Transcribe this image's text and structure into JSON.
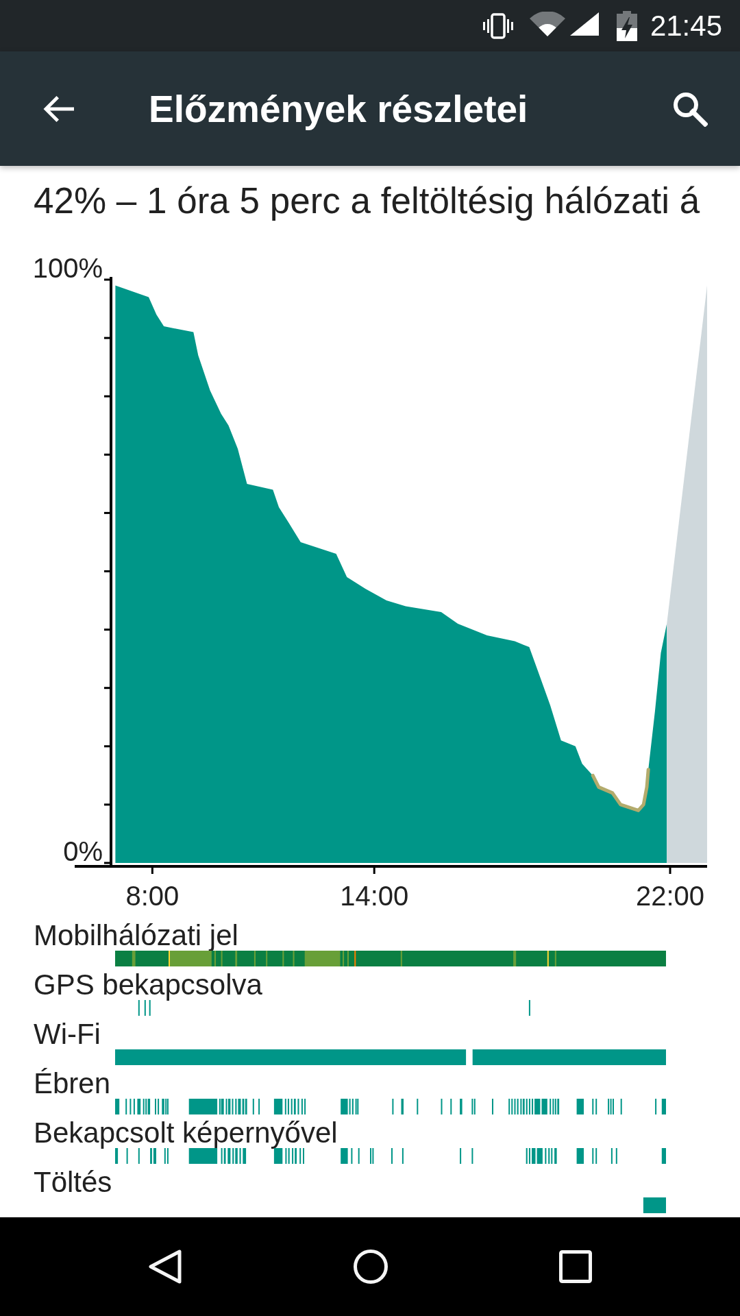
{
  "status_bar": {
    "time": "21:45"
  },
  "toolbar": {
    "title": "Előzmények részletei"
  },
  "summary": "42% – 1 óra 5 perc a feltöltésig hálózati á",
  "chart": {
    "chart_data": {
      "type": "area",
      "x": [
        7.0,
        7.9,
        8.11,
        8.31,
        9.11,
        9.24,
        9.56,
        9.86,
        10.06,
        10.31,
        10.56,
        11.26,
        11.42,
        11.72,
        12.01,
        12.97,
        13.26,
        13.76,
        14.33,
        14.85,
        15.81,
        16.26,
        17.05,
        17.8,
        18.19,
        18.42,
        18.76,
        19.05,
        19.44,
        19.62,
        19.91,
        20.07,
        20.44,
        20.66,
        21.14,
        21.28,
        21.37,
        21.41,
        21.59,
        21.75,
        21.91,
        23.0
      ],
      "xlim": [
        5.9,
        23
      ],
      "ylim": [
        0,
        100
      ],
      "xticks": [
        {
          "value": 8,
          "label": "8:00"
        },
        {
          "value": 14,
          "label": "14:00"
        },
        {
          "value": 22,
          "label": "22:00"
        }
      ],
      "yticks": [
        {
          "value": 0,
          "label": "0%"
        },
        {
          "value": 100,
          "label": "100%"
        }
      ],
      "series": [
        {
          "color": "#009688",
          "values": [
            99,
            97,
            94,
            92,
            91,
            87,
            81,
            77,
            75,
            71,
            65,
            64,
            61,
            58,
            55,
            53,
            49,
            47,
            45,
            44,
            43,
            41,
            39,
            38,
            37,
            33,
            27,
            21,
            20,
            17,
            15,
            13,
            12,
            10,
            9,
            10,
            13,
            16,
            26,
            36,
            41,
            null
          ]
        },
        {
          "color": "#cfd8dc",
          "values": [
            null,
            null,
            null,
            null,
            null,
            null,
            null,
            null,
            null,
            null,
            null,
            null,
            null,
            null,
            null,
            null,
            null,
            null,
            null,
            null,
            null,
            null,
            null,
            null,
            null,
            null,
            null,
            null,
            null,
            null,
            null,
            null,
            null,
            null,
            null,
            null,
            null,
            null,
            null,
            null,
            41,
            99
          ]
        },
        {
          "type": "line",
          "color": "#b3ab6c",
          "values": [
            null,
            null,
            null,
            null,
            null,
            null,
            null,
            null,
            null,
            null,
            null,
            null,
            null,
            null,
            null,
            null,
            null,
            null,
            null,
            null,
            null,
            null,
            null,
            null,
            null,
            null,
            null,
            null,
            null,
            null,
            15,
            13,
            12,
            10,
            9,
            10,
            13,
            16,
            null,
            null,
            null,
            null
          ]
        }
      ]
    }
  },
  "tracks": [
    {
      "label": "Mobilhálózati jel",
      "kind": "signal"
    },
    {
      "label": "GPS bekapcsolva",
      "kind": "gps"
    },
    {
      "label": "Wi-Fi",
      "kind": "wifi"
    },
    {
      "label": "Ébren",
      "kind": "awake"
    },
    {
      "label": "Bekapcsolt képernyővel",
      "kind": "screen"
    },
    {
      "label": "Töltés",
      "kind": "charging"
    }
  ]
}
